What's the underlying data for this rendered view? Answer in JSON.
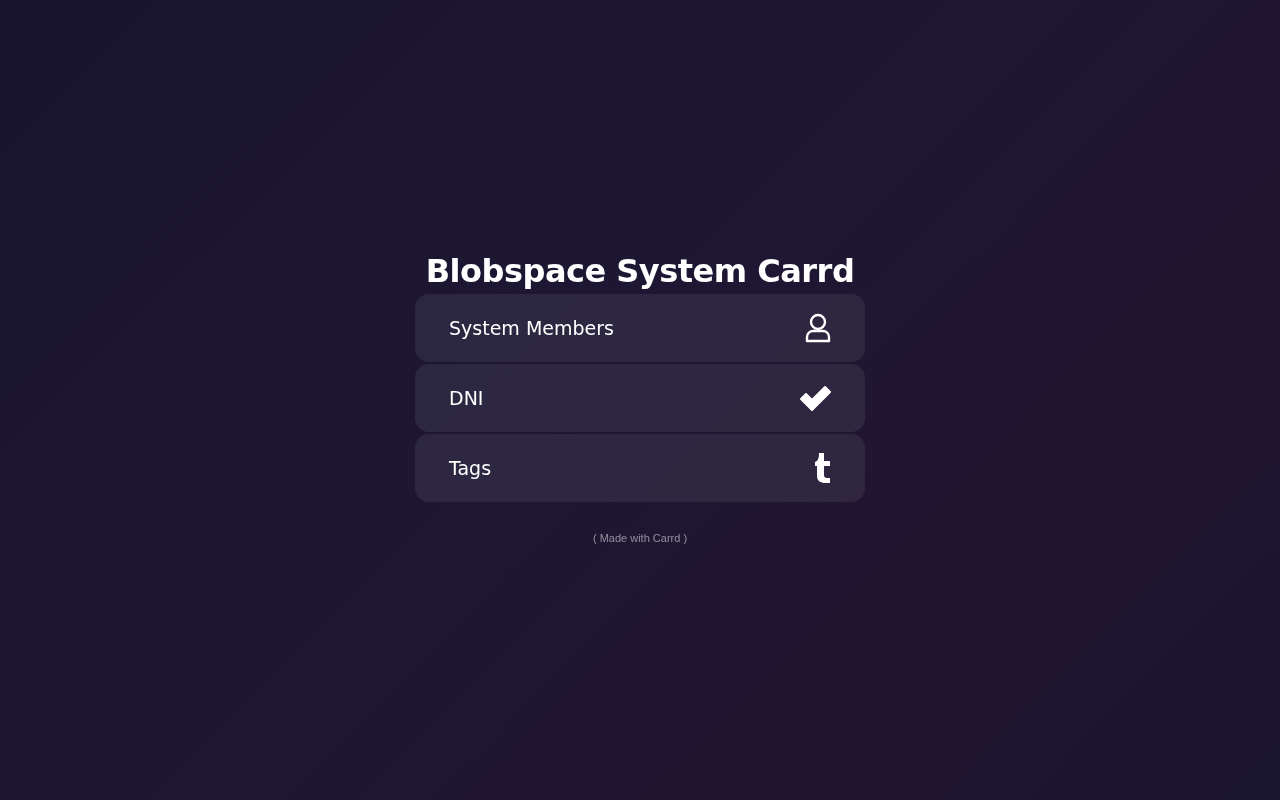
{
  "title": "Blobspace System Carrd",
  "links": [
    {
      "label": "System Members",
      "kind": "person"
    },
    {
      "label": "DNI",
      "kind": "check"
    },
    {
      "label": "Tags",
      "kind": "tumblr"
    }
  ],
  "footer": "( Made with Carrd )"
}
